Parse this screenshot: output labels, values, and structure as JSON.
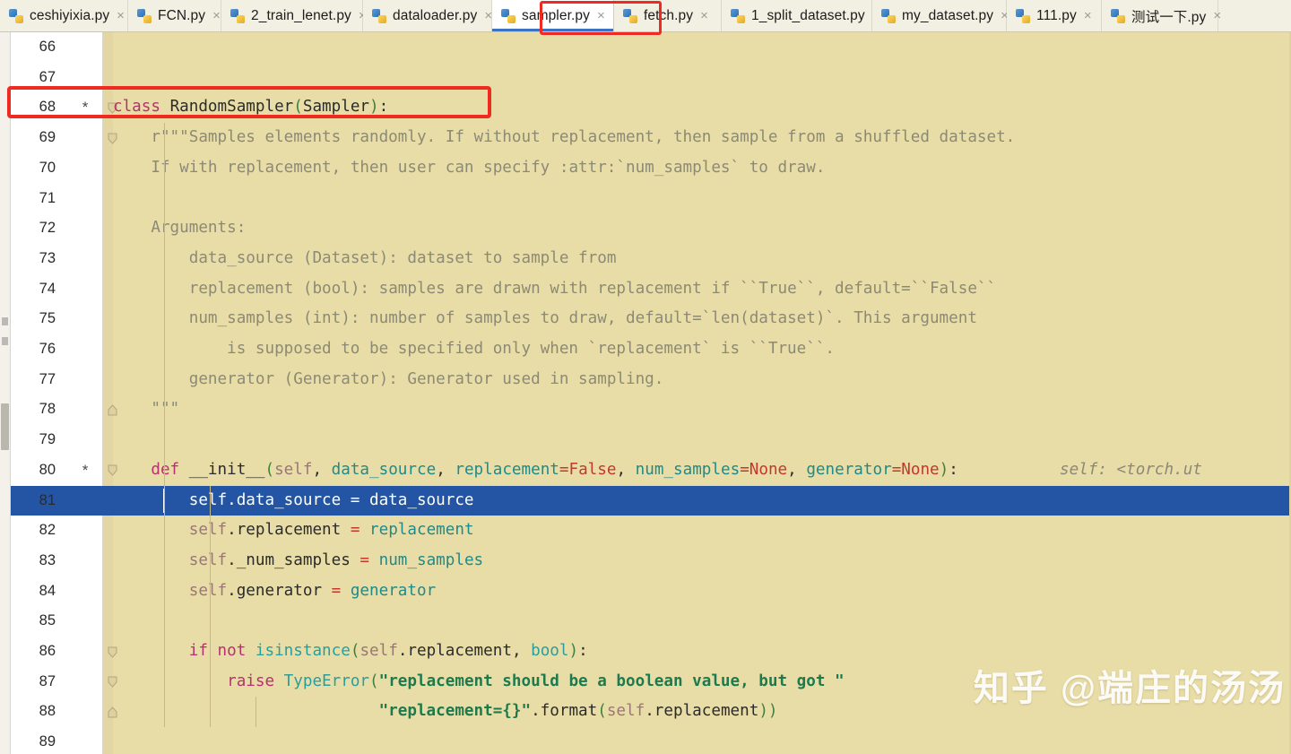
{
  "window": {
    "app": "PyCharm-like Python editor",
    "watermark": "知乎 @端庄的汤汤"
  },
  "colors": {
    "editor_background": "#e9dda7",
    "gutter_background": "#ffffff",
    "selection": "#2455a4",
    "highlight_box": "#ee2a21",
    "active_tab_underline": "#3b72c4",
    "keyword": "#b5326e",
    "string": "#1d7a4d",
    "docstring": "#8c8a74",
    "parameter": "#1f8a8a",
    "literal": "#c0392b"
  },
  "tabs": [
    {
      "label": "ceshiyixia.py",
      "icon": "python-file-icon",
      "close": "×",
      "active": false
    },
    {
      "label": "FCN.py",
      "icon": "python-file-icon",
      "close": "×",
      "active": false
    },
    {
      "label": "2_train_lenet.py",
      "icon": "python-file-icon",
      "close": "×",
      "active": false
    },
    {
      "label": "dataloader.py",
      "icon": "python-file-icon",
      "close": "×",
      "active": false
    },
    {
      "label": "sampler.py",
      "icon": "python-file-icon",
      "close": "×",
      "active": true
    },
    {
      "label": "fetch.py",
      "icon": "python-file-icon",
      "close": "×",
      "active": false
    },
    {
      "label": "1_split_dataset.py",
      "icon": "python-file-icon",
      "close": "×",
      "active": false
    },
    {
      "label": "my_dataset.py",
      "icon": "python-file-icon",
      "close": "×",
      "active": false
    },
    {
      "label": "111.py",
      "icon": "python-file-icon",
      "close": "×",
      "active": false
    },
    {
      "label": "测试一下.py",
      "icon": "python-file-icon",
      "close": "×",
      "active": false
    }
  ],
  "editor": {
    "first_line": 66,
    "last_line": 89,
    "selected_line": 81,
    "inline_hint_line80": "self: <torch.ut",
    "lines": [
      {
        "n": 66,
        "star": "",
        "fold": "",
        "text": ""
      },
      {
        "n": 67,
        "star": "",
        "fold": "",
        "text": ""
      },
      {
        "n": 68,
        "star": "*",
        "fold": "down",
        "text": "class RandomSampler(Sampler):"
      },
      {
        "n": 69,
        "star": "",
        "fold": "down",
        "text": "    r\"\"\"Samples elements randomly. If without replacement, then sample from a shuffled dataset."
      },
      {
        "n": 70,
        "star": "",
        "fold": "",
        "text": "    If with replacement, then user can specify :attr:`num_samples` to draw."
      },
      {
        "n": 71,
        "star": "",
        "fold": "",
        "text": ""
      },
      {
        "n": 72,
        "star": "",
        "fold": "",
        "text": "    Arguments:"
      },
      {
        "n": 73,
        "star": "",
        "fold": "",
        "text": "        data_source (Dataset): dataset to sample from"
      },
      {
        "n": 74,
        "star": "",
        "fold": "",
        "text": "        replacement (bool): samples are drawn with replacement if ``True``, default=``False``"
      },
      {
        "n": 75,
        "star": "",
        "fold": "",
        "text": "        num_samples (int): number of samples to draw, default=`len(dataset)`. This argument"
      },
      {
        "n": 76,
        "star": "",
        "fold": "",
        "text": "            is supposed to be specified only when `replacement` is ``True``."
      },
      {
        "n": 77,
        "star": "",
        "fold": "",
        "text": "        generator (Generator): Generator used in sampling."
      },
      {
        "n": 78,
        "star": "",
        "fold": "up",
        "text": "    \"\"\""
      },
      {
        "n": 79,
        "star": "",
        "fold": "",
        "text": ""
      },
      {
        "n": 80,
        "star": "*",
        "fold": "down",
        "text": "    def __init__(self, data_source, replacement=False, num_samples=None, generator=None):"
      },
      {
        "n": 81,
        "star": "",
        "fold": "",
        "text": "        self.data_source = data_source"
      },
      {
        "n": 82,
        "star": "",
        "fold": "",
        "text": "        self.replacement = replacement"
      },
      {
        "n": 83,
        "star": "",
        "fold": "",
        "text": "        self._num_samples = num_samples"
      },
      {
        "n": 84,
        "star": "",
        "fold": "",
        "text": "        self.generator = generator"
      },
      {
        "n": 85,
        "star": "",
        "fold": "",
        "text": ""
      },
      {
        "n": 86,
        "star": "",
        "fold": "down",
        "text": "        if not isinstance(self.replacement, bool):"
      },
      {
        "n": 87,
        "star": "",
        "fold": "down",
        "text": "            raise TypeError(\"replacement should be a boolean value, but got \""
      },
      {
        "n": 88,
        "star": "",
        "fold": "up",
        "text": "                            \"replacement={}\".format(self.replacement))"
      },
      {
        "n": 89,
        "star": "",
        "fold": "",
        "text": ""
      }
    ]
  },
  "annotations": {
    "tab_highlight_target": "sampler.py",
    "class_highlight_target": "class RandomSampler(Sampler):"
  }
}
